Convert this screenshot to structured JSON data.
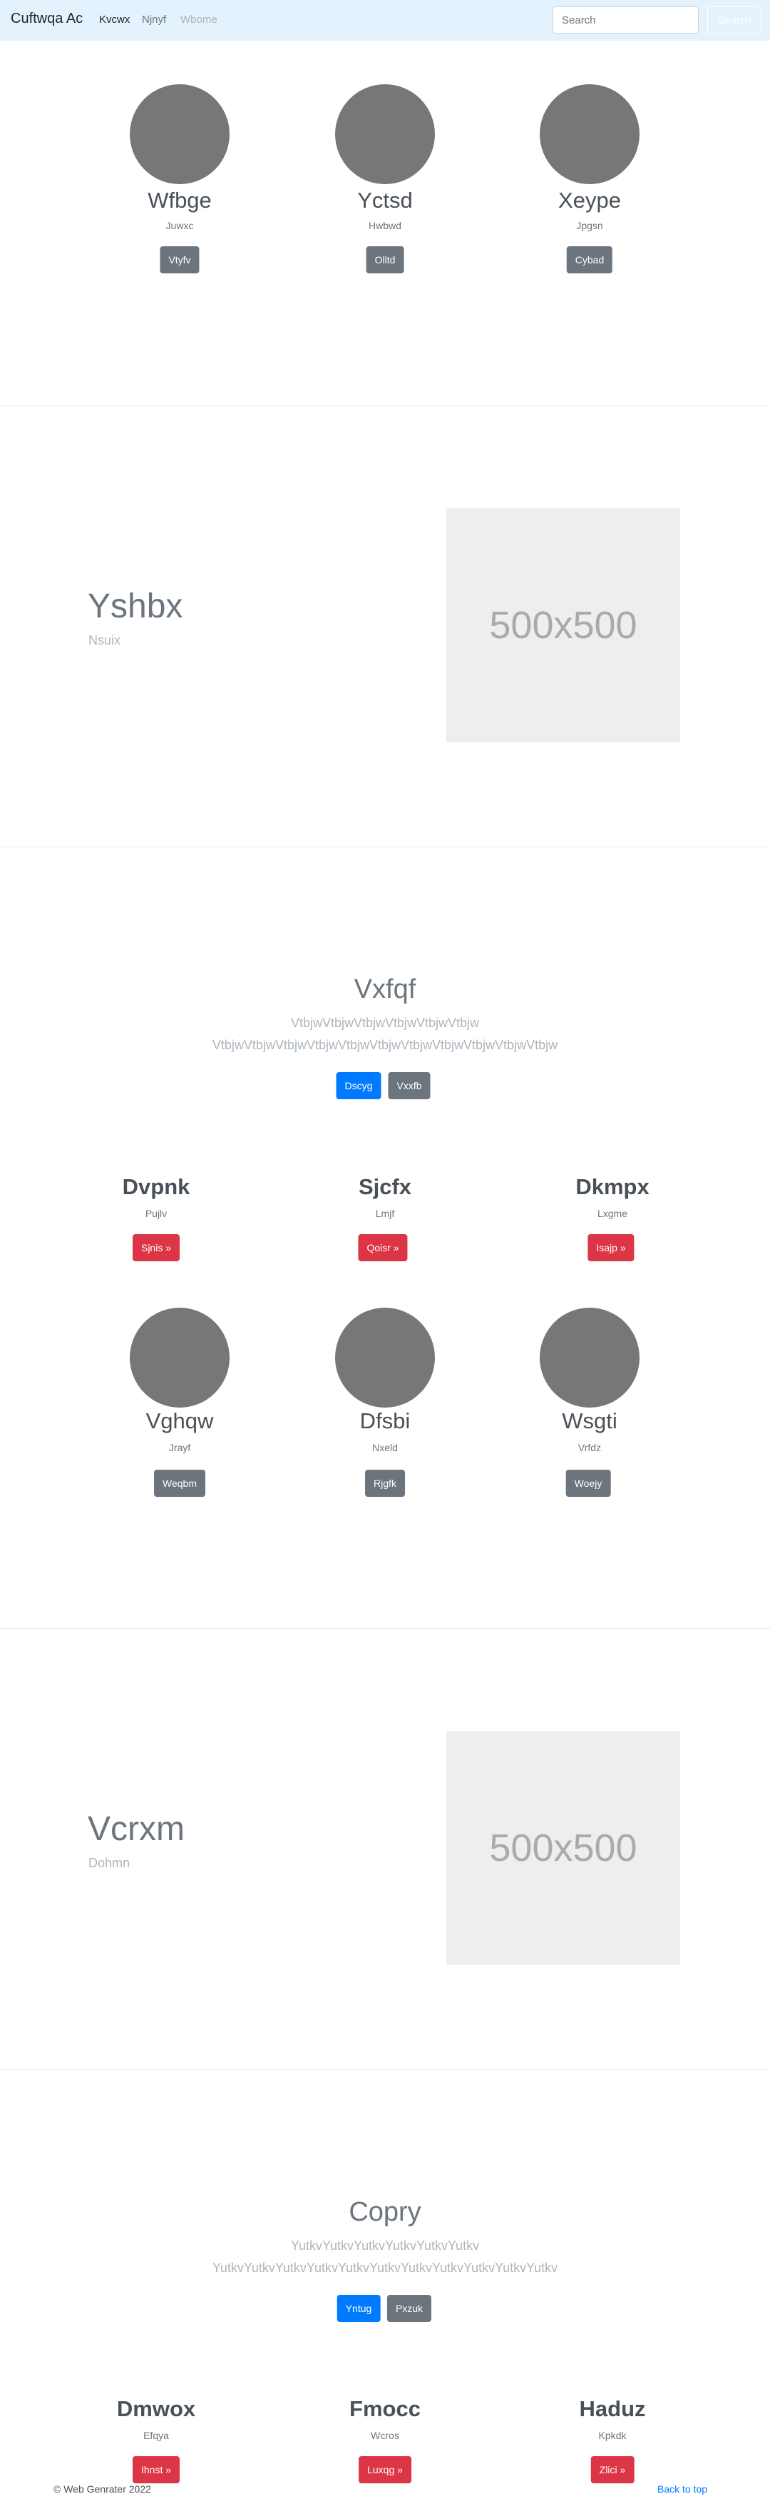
{
  "navbar": {
    "brand": "Cuftwqa Ac",
    "links": [
      {
        "label": "Kvcwx",
        "state": "active"
      },
      {
        "label": "Njnyf",
        "state": "normal"
      },
      {
        "label": "Wbome",
        "state": "disabled"
      }
    ],
    "search_placeholder": "Search",
    "search_button": "Search",
    "colors": {
      "background": "#e3f2fd"
    }
  },
  "team_top": [
    {
      "name": "Wfbge",
      "role": "Juwxc",
      "button": "Vtyfv"
    },
    {
      "name": "Yctsd",
      "role": "Hwbwd",
      "button": "Olltd"
    },
    {
      "name": "Xeype",
      "role": "Jpgsn",
      "button": "Cybad"
    }
  ],
  "feature_1": {
    "title": "Yshbx",
    "subtitle": "Nsuix",
    "image_label": "500x500"
  },
  "jumbo_1": {
    "title": "Vxfqf",
    "text": "VtbjwVtbjwVtbjwVtbjwVtbjwVtbjw VtbjwVtbjwVtbjwVtbjwVtbjwVtbjwVtbjwVtbjwVtbjwVtbjwVtbjw",
    "primary_button": "Dscyg",
    "secondary_button": "Vxxfb"
  },
  "columns_1": [
    {
      "title": "Dvpnk",
      "text": "Pujlv",
      "button": "Sjnis »"
    },
    {
      "title": "Sjcfx",
      "text": "Lmjf",
      "button": "Qoisr »"
    },
    {
      "title": "Dkmpx",
      "text": "Lxgme",
      "button": "Isajp »"
    }
  ],
  "team_bottom": [
    {
      "name": "Vghqw",
      "role": "Jrayf",
      "button": "Weqbm"
    },
    {
      "name": "Dfsbi",
      "role": "Nxeld",
      "button": "Rjgfk"
    },
    {
      "name": "Wsgti",
      "role": "Vrfdz",
      "button": "Woejy"
    }
  ],
  "feature_2": {
    "title": "Vcrxm",
    "subtitle": "Dohmn",
    "image_label": "500x500"
  },
  "jumbo_2": {
    "title": "Copry",
    "text": "YutkvYutkvYutkvYutkvYutkvYutkv YutkvYutkvYutkvYutkvYutkvYutkvYutkvYutkvYutkvYutkvYutkv",
    "primary_button": "Yntug",
    "secondary_button": "Pxzuk"
  },
  "columns_2": [
    {
      "title": "Dmwox",
      "text": "Efqya",
      "button": "Ihnst »"
    },
    {
      "title": "Fmocc",
      "text": "Wcros",
      "button": "Luxqg »"
    },
    {
      "title": "Haduz",
      "text": "Kpkdk",
      "button": "Zlici »"
    }
  ],
  "footer": {
    "copyright": "© Web Genrater 2022",
    "back_to_top": "Back to top"
  }
}
